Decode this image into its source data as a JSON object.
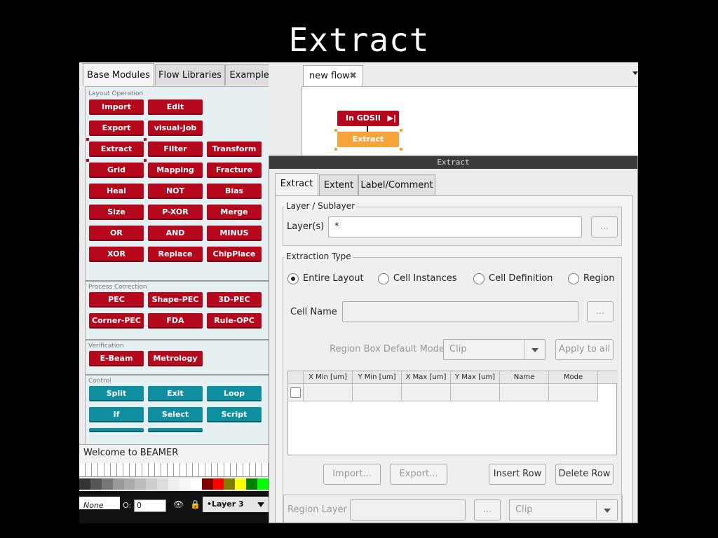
{
  "slide_title": "Extract",
  "left_panel": {
    "tabs": [
      "Base Modules",
      "Flow Libraries",
      "Examples"
    ],
    "sections": {
      "layout_operation": {
        "label": "Layout Operation",
        "buttons": [
          "Import",
          "Edit",
          "Export",
          "visual-Job",
          "Extract",
          "Filter",
          "Transform",
          "Grid",
          "Mapping",
          "Fracture",
          "Heal",
          "NOT",
          "Bias",
          "Size",
          "P-XOR",
          "Merge",
          "OR",
          "AND",
          "MINUS",
          "XOR",
          "Replace",
          "ChipPlace"
        ]
      },
      "process_correction": {
        "label": "Process Correction",
        "buttons": [
          "PEC",
          "Shape-PEC",
          "3D-PEC",
          "Corner-PEC",
          "FDA",
          "Rule-OPC"
        ]
      },
      "verification": {
        "label": "Verification",
        "buttons": [
          "E-Beam",
          "Metrology"
        ]
      },
      "control": {
        "label": "Control",
        "buttons": [
          "Split",
          "Exit",
          "Loop",
          "If",
          "Select",
          "Script"
        ]
      }
    },
    "status": "Welcome to BEAMER",
    "palette": [
      "#333333",
      "#555555",
      "#777777",
      "#999999",
      "#aaaaaa",
      "#bbbbbb",
      "#cccccc",
      "#dddddd",
      "#eeeeee",
      "#f6f6f6",
      "#ffffff",
      "#800000",
      "#ff0000",
      "#808000",
      "#ffff00",
      "#008000",
      "#00ff00"
    ],
    "layer_bar": {
      "name_value": "None",
      "o_label": "O:",
      "o_value": "0",
      "layer_label": "•Layer 3"
    }
  },
  "flow": {
    "tab_label": "new flow",
    "nodes": [
      "In GDSII",
      "Extract"
    ],
    "node_colors": {
      "in": "#b5081c",
      "extract": "#f7a23a"
    }
  },
  "dialog": {
    "title": "Extract",
    "tabs": [
      "Extract",
      "Extent",
      "Label/Comment"
    ],
    "layer_group": {
      "title": "Layer / Sublayer",
      "layers_label": "Layer(s)",
      "layers_value": "*",
      "browse": "..."
    },
    "extraction_group": {
      "title": "Extraction Type",
      "options": [
        "Entire Layout",
        "Cell Instances",
        "Cell Definition",
        "Region"
      ],
      "selected": "Entire Layout",
      "cell_name_label": "Cell Name",
      "cell_name_value": "",
      "browse": "...",
      "region_mode_label": "Region Box Default Mode",
      "region_mode_value": "Clip",
      "apply_all": "Apply to all",
      "table_headers": [
        "X Min [um]",
        "Y Min [um]",
        "X Max [um]",
        "Y Max [um]",
        "Name",
        "Mode"
      ],
      "import": "Import...",
      "export": "Export...",
      "insert_row": "Insert Row",
      "delete_row": "Delete Row",
      "region_layer_label": "Region Layer",
      "region_layer_browse": "...",
      "region_layer_mode": "Clip"
    }
  }
}
